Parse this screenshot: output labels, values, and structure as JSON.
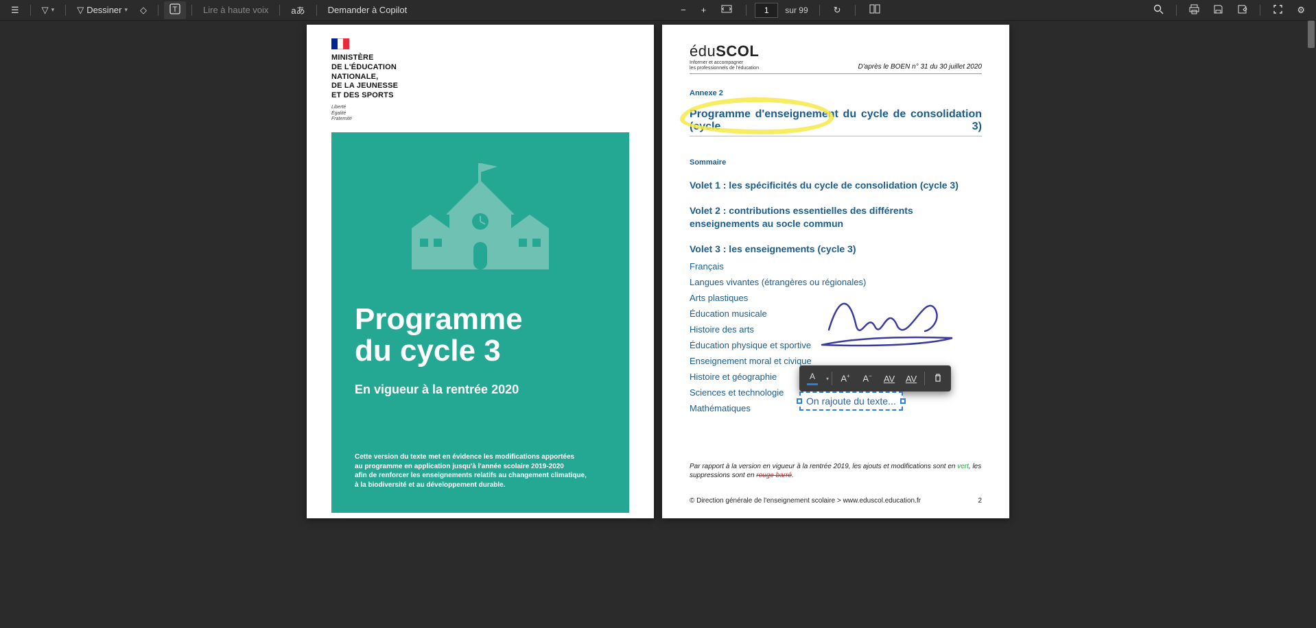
{
  "toolbar": {
    "draw_label": "Dessiner",
    "read_aloud_label": "Lire à haute voix",
    "ask_copilot_label": "Demander à Copilot",
    "page_current": "1",
    "page_total_prefix": "sur",
    "page_total": "99"
  },
  "page1": {
    "ministry_l1": "MINISTÈRE",
    "ministry_l2": "DE L'ÉDUCATION",
    "ministry_l3": "NATIONALE,",
    "ministry_l4": "DE LA JEUNESSE",
    "ministry_l5": "ET DES SPORTS",
    "motto_l1": "Liberté",
    "motto_l2": "Égalité",
    "motto_l3": "Fraternité",
    "cover_title_l1": "Programme",
    "cover_title_l2": "du cycle 3",
    "cover_sub": "En vigueur à la rentrée 2020",
    "cover_small_l1": "Cette version du texte met en évidence les modifications apportées",
    "cover_small_l2": "au programme en application jusqu'à l'année scolaire 2019-2020",
    "cover_small_l3": "afin de renforcer les enseignements relatifs au changement climatique,",
    "cover_small_l4": "à la biodiversité et au développement durable."
  },
  "page2": {
    "brand_edu": "édu",
    "brand_scol": "SCOL",
    "brand_sub_l1": "Informer et accompagner",
    "brand_sub_l2": "les professionnels de l'éducation",
    "boen": "D'après le BOEN n° 31 du 30 juillet 2020",
    "annexe": "Annexe 2",
    "title": "Programme d'enseignement du cycle de consolidation (cycle 3)",
    "sommaire": "Sommaire",
    "volet1": "Volet 1 : les spécificités du cycle de consolidation (cycle 3)",
    "volet2": "Volet 2 : contributions essentielles des différents enseignements au socle commun",
    "volet3": "Volet 3 : les enseignements (cycle 3)",
    "items": [
      "Français",
      "Langues vivantes (étrangères ou régionales)",
      "Arts plastiques",
      "Éducation musicale",
      "Histoire des arts",
      "Éducation physique et sportive",
      "Enseignement moral et civique",
      "Histoire et géographie",
      "Sciences et technologie",
      "Mathématiques"
    ],
    "foot_a": "Par rapport à la version en vigueur à la rentrée 2019, les ajouts et modifications sont en ",
    "foot_green": "vert",
    "foot_b": ", les suppressions sont en ",
    "foot_red": "rouge barré",
    "foot_c": ".",
    "copy": "© Direction générale de l'enseignement scolaire > www.eduscol.education.fr",
    "page_num": "2"
  },
  "annotation": {
    "textbox_value": "On rajoute du texte..."
  }
}
